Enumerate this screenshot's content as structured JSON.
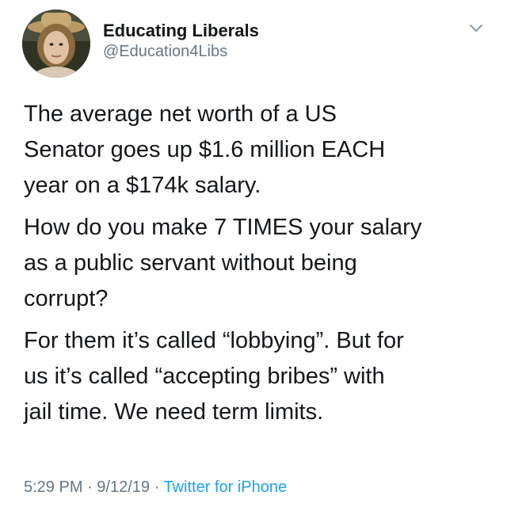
{
  "user": {
    "display_name": "Educating Liberals",
    "handle": "@Education4Libs",
    "avatar": "profile-photo"
  },
  "menu": {
    "icon": "chevron-down-icon"
  },
  "tweet": {
    "paragraphs": [
      "The average net worth of a US\nSenator goes up $1.6 million EACH\nyear on a $174k salary.",
      "How do you make 7 TIMES your salary\nas a public servant without being\ncorrupt?",
      "For them it’s called “lobbying”. But for\nus it’s called “accepting bribes” with\njail time. We need term limits."
    ]
  },
  "meta": {
    "time": "5:29 PM",
    "date": "9/12/19",
    "source": "Twitter for iPhone",
    "separator": "·"
  },
  "colors": {
    "text": "#14171a",
    "secondary": "#657786",
    "link": "#1da1f2"
  }
}
